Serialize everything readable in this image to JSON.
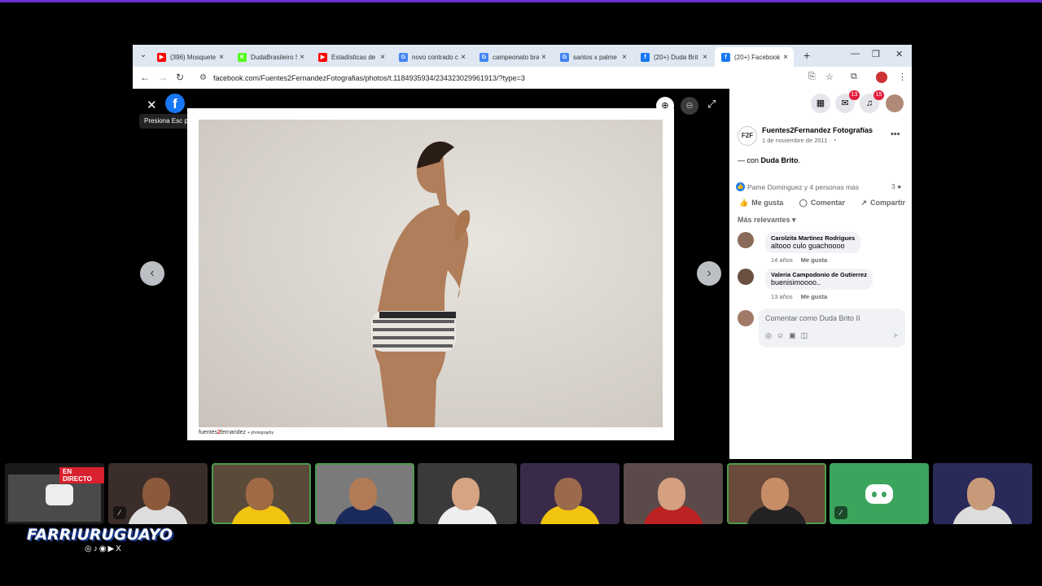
{
  "browser": {
    "tabs": [
      {
        "title": "(396) Mosquete",
        "icon": "youtube-icon",
        "color": "#ff0000",
        "glyph": "▶"
      },
      {
        "title": "DudaBrasileiro St",
        "icon": "kick-icon",
        "color": "#53fc18",
        "glyph": "K"
      },
      {
        "title": "Estadísticas de",
        "icon": "youtube-icon",
        "color": "#ff0000",
        "glyph": "▶"
      },
      {
        "title": "novo contrado c",
        "icon": "google-icon",
        "color": "#4285f4",
        "glyph": "G"
      },
      {
        "title": "campeonato bra",
        "icon": "google-icon",
        "color": "#4285f4",
        "glyph": "G"
      },
      {
        "title": "santos x palme",
        "icon": "google-icon",
        "color": "#4285f4",
        "glyph": "G"
      },
      {
        "title": "(20+) Duda Brit",
        "icon": "facebook-icon",
        "color": "#1877f2",
        "glyph": "f"
      },
      {
        "title": "(20+) Facebook",
        "icon": "facebook-icon",
        "color": "#1877f2",
        "glyph": "f",
        "active": true
      }
    ],
    "url": "facebook.com/Fuentes2FernandezFotografias/photos/t.1184935934/234323029961913/?type=3"
  },
  "viewer": {
    "tooltip": "Presiona Esc para cerrar",
    "fb_glyph": "f",
    "photo_credit_pre": "fuentes",
    "photo_credit_num": "2",
    "photo_credit_post": "fernandez",
    "photo_credit_small": "+ photography"
  },
  "sidepanel": {
    "messenger_badge": "13",
    "notifications_badge": "15",
    "page_avatar": "F2F",
    "page_name": "Fuentes2Fernandez Fotografías",
    "post_date": "1 de noviembre de 2011 · ◔",
    "with_prefix": "— con ",
    "with_name": "Duda Brito",
    "with_suffix": ".",
    "reactions": "Pame Dominguez y 4 personas más",
    "comment_count": "3 ●",
    "actions": {
      "like": "Me gusta",
      "comment": "Comentar",
      "share": "Compartir"
    },
    "sort_label": "Más relevantes ▾",
    "comments": [
      {
        "name": "Carolzita Martinez Rodrigues",
        "text": "altooo culo guachoooo",
        "age": "14 años",
        "like": "Me gusta"
      },
      {
        "name": "Valeria Campodonio de Gutierrez",
        "text": "buenisimoooo..",
        "age": "13 años",
        "like": "Me gusta"
      }
    ],
    "write_placeholder": "Comentar como Duda Brito II"
  },
  "stream": {
    "live_badge": "EN DIRECTO",
    "brand": "FARRIURUGUAYO",
    "brand_social": "◎♪◉▶X"
  }
}
